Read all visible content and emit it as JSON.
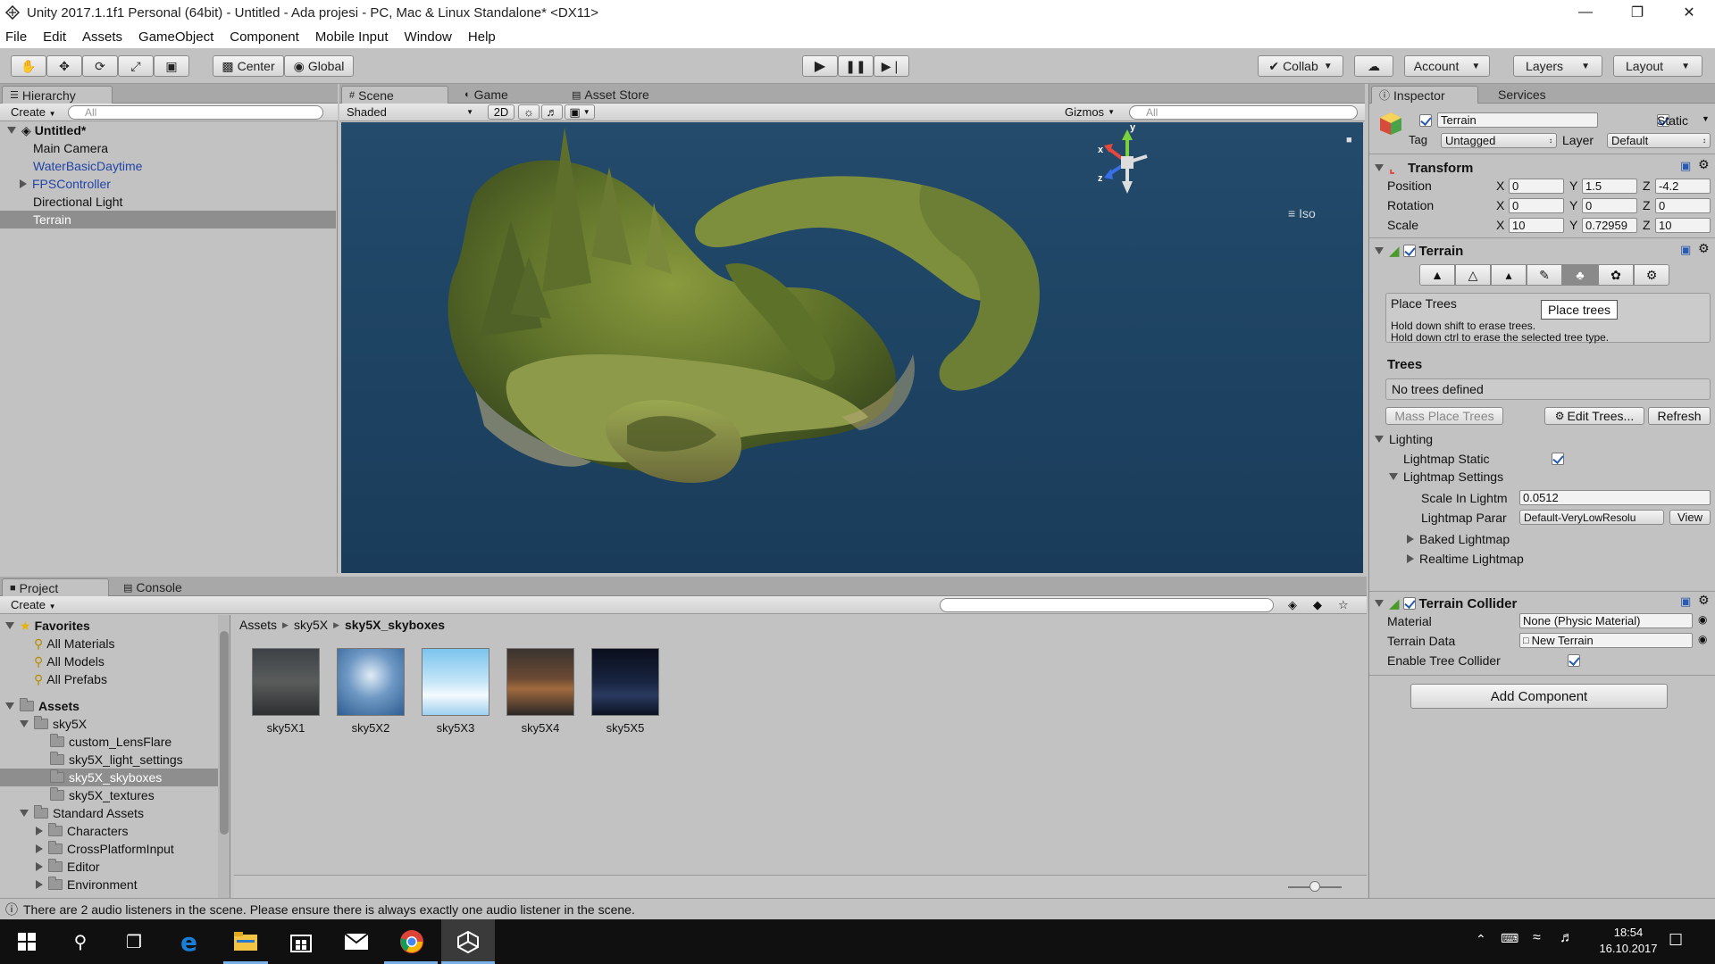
{
  "window": {
    "title": "Unity 2017.1.1f1 Personal (64bit) - Untitled - Ada projesi - PC, Mac & Linux Standalone* <DX11>"
  },
  "menu": [
    "File",
    "Edit",
    "Assets",
    "GameObject",
    "Component",
    "Mobile Input",
    "Window",
    "Help"
  ],
  "toolbar": {
    "center": "Center",
    "global": "Global",
    "collab": "Collab",
    "account": "Account",
    "layers": "Layers",
    "layout": "Layout"
  },
  "hierarchy": {
    "tab": "Hierarchy",
    "create": "Create",
    "search_placeholder": "All",
    "scene": "Untitled*",
    "items": [
      "Main Camera",
      "WaterBasicDaytime",
      "FPSController",
      "Directional Light",
      "Terrain"
    ]
  },
  "scene": {
    "tabs": [
      "Scene",
      "Game",
      "Asset Store"
    ],
    "shading": "Shaded",
    "mode2d": "2D",
    "gizmos": "Gizmos",
    "search_placeholder": "All",
    "iso": "Iso",
    "axis_labels": [
      "y",
      "x",
      "z"
    ]
  },
  "inspector": {
    "tabs": [
      "Inspector",
      "Services"
    ],
    "object_name": "Terrain",
    "static_label": "Static",
    "tag_label": "Tag",
    "tag_value": "Untagged",
    "layer_label": "Layer",
    "layer_value": "Default",
    "transform": {
      "title": "Transform",
      "position_label": "Position",
      "rotation_label": "Rotation",
      "scale_label": "Scale",
      "axis": [
        "X",
        "Y",
        "Z"
      ],
      "position": [
        "0",
        "1.5",
        "-4.2"
      ],
      "rotation": [
        "0",
        "0",
        "0"
      ],
      "scale": [
        "10",
        "0.72959",
        "10"
      ]
    },
    "terrain": {
      "title": "Terrain",
      "place_trees": "Place Trees",
      "tooltip": "Place trees",
      "hint1": "Hold down shift to erase trees.",
      "hint2": "Hold down ctrl to erase the selected tree type.",
      "trees_header": "Trees",
      "no_trees": "No trees defined",
      "mass_place": "Mass Place Trees",
      "edit_trees": "Edit Trees...",
      "refresh": "Refresh",
      "lighting": "Lighting",
      "lightmap_static": "Lightmap Static",
      "lightmap_settings": "Lightmap Settings",
      "scale_label": "Scale In Lightm",
      "scale_value": "0.0512",
      "params_label": "Lightmap Parar",
      "params_value": "Default-VeryLowResolu",
      "view": "View",
      "baked": "Baked Lightmap",
      "realtime": "Realtime Lightmap"
    },
    "collider": {
      "title": "Terrain Collider",
      "material_label": "Material",
      "material_value": "None (Physic Material)",
      "data_label": "Terrain Data",
      "data_value": "New Terrain",
      "enable_label": "Enable Tree Collider"
    },
    "add_component": "Add Component"
  },
  "project": {
    "tabs": [
      "Project",
      "Console"
    ],
    "create": "Create",
    "favorites": "Favorites",
    "fav_items": [
      "All Materials",
      "All Models",
      "All Prefabs"
    ],
    "assets": "Assets",
    "tree": [
      "sky5X",
      "custom_LensFlare",
      "sky5X_light_settings",
      "sky5X_skyboxes",
      "sky5X_textures",
      "Standard Assets",
      "Characters",
      "CrossPlatformInput",
      "Editor",
      "Environment"
    ],
    "breadcrumb": [
      "Assets",
      "sky5X",
      "sky5X_skyboxes"
    ],
    "files": [
      "sky5X1",
      "sky5X2",
      "sky5X3",
      "sky5X4",
      "sky5X5"
    ]
  },
  "status": "There are 2 audio listeners in the scene. Please ensure there is always exactly one audio listener in the scene.",
  "taskbar": {
    "time": "18:54",
    "date": "16.10.2017"
  }
}
